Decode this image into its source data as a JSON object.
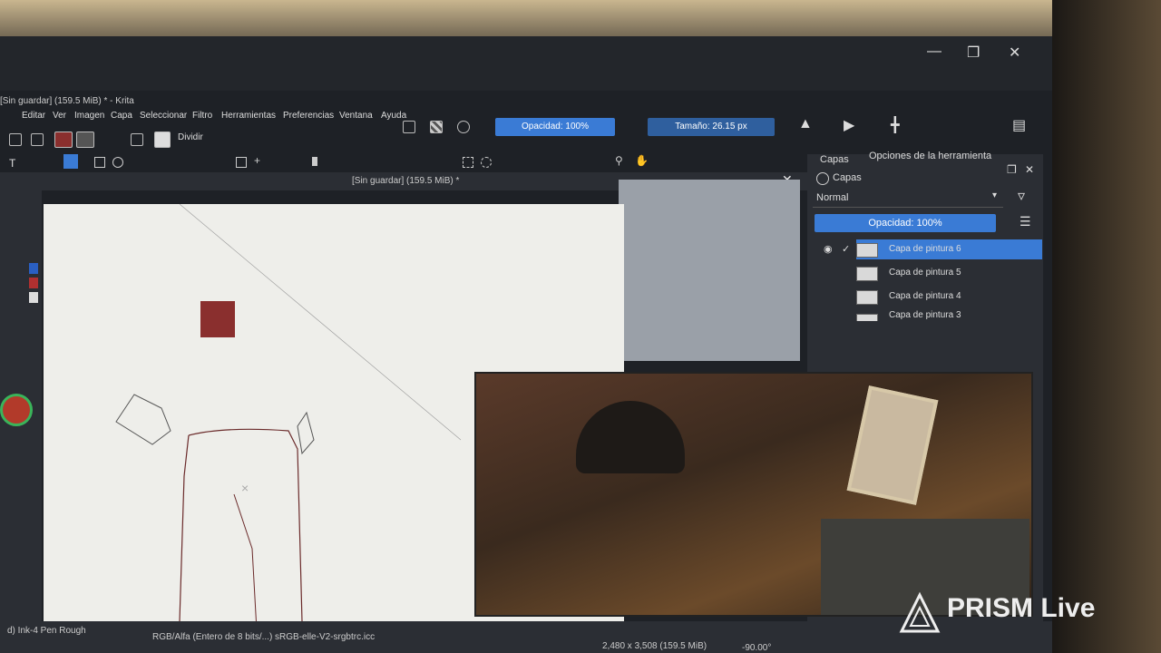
{
  "window": {
    "title": "[Sin guardar] (159.5 MiB) * - Krita",
    "minimize_icon": "minimize-icon",
    "restore_icon": "restore-icon",
    "close_icon": "close-icon"
  },
  "menu": {
    "items": [
      "Editar",
      "Ver",
      "Imagen",
      "Capa",
      "Seleccionar",
      "Filtro",
      "Herramientas",
      "Preferencias",
      "Ventana",
      "Ayuda"
    ]
  },
  "toolbar": {
    "split_label": "Dividir",
    "opacity_label": "Opacidad: 100%",
    "size_label": "Tamaño: 26.15 px"
  },
  "document": {
    "tab_title": "[Sin guardar] (159.5 MiB) *"
  },
  "layers_panel": {
    "tab_layers": "Capas",
    "tab_tool_options": "Opciones de la herramienta",
    "header": "Capas",
    "blend_mode": "Normal",
    "opacity_label": "Opacidad: 100%",
    "layers": [
      {
        "name": "Capa de pintura 6",
        "selected": true
      },
      {
        "name": "Capa de pintura 5",
        "selected": false
      },
      {
        "name": "Capa de pintura 4",
        "selected": false
      },
      {
        "name": "Capa de pintura 3",
        "selected": false
      }
    ]
  },
  "status": {
    "brush": "d) Ink-4 Pen Rough",
    "color_profile": "RGB/Alfa (Entero de 8 bits/...) sRGB-elle-V2-srgbtrc.icc",
    "image_size": "2,480 x 3,508 (159.5 MiB)",
    "rotation": "-90.00°"
  },
  "overlay": {
    "brand": "PRISM Live"
  },
  "colors": {
    "accent": "#3a7bd5",
    "swatch": "#8a2f2e"
  }
}
